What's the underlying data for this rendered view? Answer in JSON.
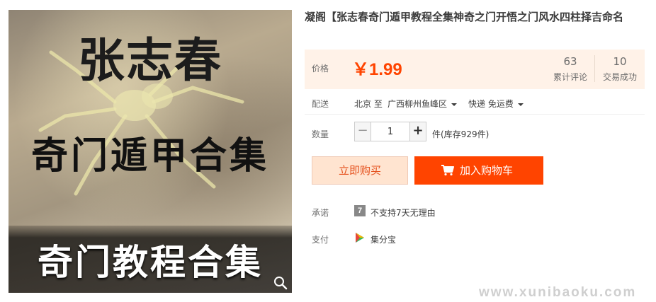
{
  "product": {
    "image": {
      "author_text": "张志春",
      "title_text": "奇门遁甲合集",
      "band_text": "奇门教程合集",
      "zoom_icon": "magnifier-icon"
    },
    "title": "凝阁【张志春奇门遁甲教程全集神奇之门开悟之门风水四柱择吉命名"
  },
  "price": {
    "label": "价格",
    "value": "￥1.99",
    "color": "#ff4400",
    "reviews_count": "63",
    "reviews_label": "累计评论",
    "deals_count": "10",
    "deals_label": "交易成功"
  },
  "delivery": {
    "label": "配送",
    "from": "北京 至",
    "to": "广西柳州鱼峰区",
    "method": "快递 免运费"
  },
  "quantity": {
    "label": "数量",
    "minus": "−",
    "value": "1",
    "plus": "+",
    "stock_text": "件(库存929件)"
  },
  "actions": {
    "buy_now": "立即购买",
    "add_to_cart": "加入购物车",
    "accent": "#ff4400"
  },
  "promise": {
    "label": "承诺",
    "badge": "7",
    "text": "不支持7天无理由"
  },
  "payment": {
    "label": "支付",
    "method": "集分宝",
    "icon": "jifenbao-icon"
  },
  "watermark": "www.xunibaoku.com"
}
